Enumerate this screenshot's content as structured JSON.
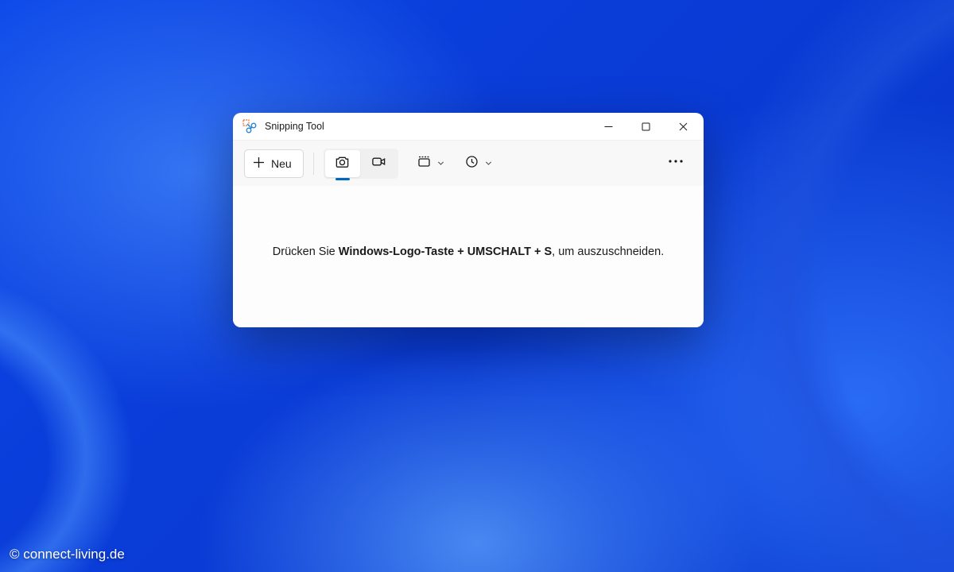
{
  "titlebar": {
    "app_title": "Snipping Tool"
  },
  "toolbar": {
    "new_label": "Neu",
    "icons": {
      "plus": "plus-icon",
      "camera": "camera-icon",
      "video": "video-icon",
      "shape": "rectangle-snip-icon",
      "delay": "clock-icon",
      "more": "more-icon"
    }
  },
  "content": {
    "instruction_prefix": "Drücken Sie ",
    "instruction_shortcut": "Windows-Logo-Taste + UMSCHALT + S",
    "instruction_suffix": ", um auszuschneiden."
  },
  "watermark": "© connect-living.de"
}
